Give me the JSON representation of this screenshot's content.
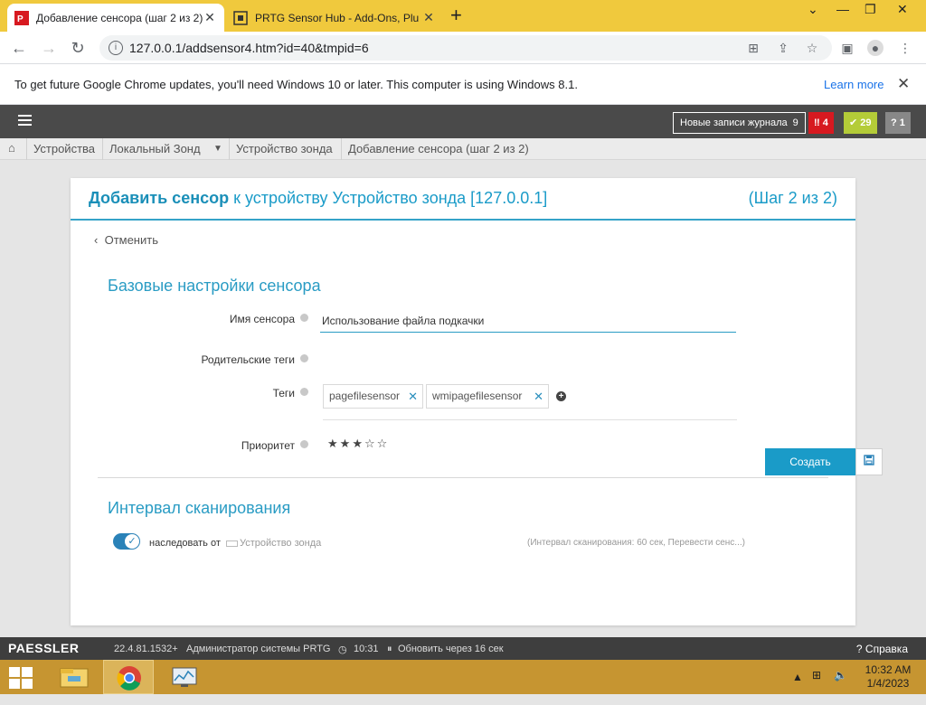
{
  "browser": {
    "tabs": [
      {
        "title": "Добавление сенсора (шаг 2 из 2)",
        "active": true
      },
      {
        "title": "PRTG Sensor Hub - Add-Ons, Plu",
        "active": false
      }
    ],
    "url": "127.0.0.1/addsensor4.htm?id=40&tmpid=6",
    "infobar": {
      "message": "To get future Google Chrome updates, you'll need Windows 10 or later. This computer is using Windows 8.1.",
      "link": "Learn more"
    }
  },
  "prtg": {
    "log_label": "Новые записи журнала",
    "log_count": "9",
    "alarm_red": "4",
    "alarm_green": "29",
    "alarm_gray": "1",
    "breadcrumbs": [
      "Устройства",
      "Локальный Зонд",
      "Устройство зонда",
      "Добавление сенсора (шаг 2 из 2)"
    ],
    "card": {
      "title_bold": "Добавить сенсор",
      "title_rest": " к устройству Устройство зонда [127.0.0.1]",
      "step": "(Шаг 2 из 2)",
      "cancel": "Отменить",
      "section_basic": "Базовые настройки сенсора",
      "label_name": "Имя сенсора",
      "value_name": "Использование файла подкачки",
      "label_parent_tags": "Родительские теги",
      "label_tags": "Теги",
      "tags": [
        "pagefilesensor",
        "wmipagefilesensor"
      ],
      "label_priority": "Приоритет",
      "priority_stars": 3,
      "priority_max": 5,
      "section_interval": "Интервал сканирования",
      "inherit_label": "наследовать от",
      "inherit_device": "Устройство зонда",
      "inherit_info": "(Интервал сканирования: 60 сек, Перевести сенс...)"
    },
    "create_button": "Создать",
    "footer": {
      "brand": "PAESSLER",
      "version": "22.4.81.1532+",
      "user": "Администратор системы PRTG",
      "time": "10:31",
      "refresh": "Обновить через 16 сек",
      "help": "Справка"
    }
  },
  "taskbar": {
    "time": "10:32 AM",
    "date": "1/4/2023"
  },
  "colors": {
    "accent": "#1a9bc8",
    "tab_bar": "#f0c93d",
    "taskbar": "#c69531",
    "alarm_red": "#d71920",
    "alarm_green": "#b4cc38",
    "alarm_gray": "#888888"
  }
}
